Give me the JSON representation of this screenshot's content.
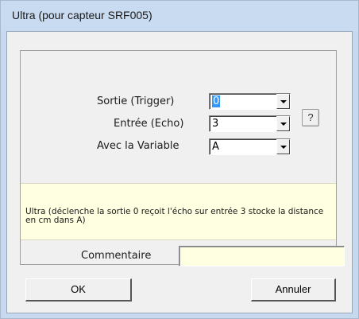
{
  "window": {
    "title": "Ultra (pour capteur SRF005)"
  },
  "form": {
    "trigger": {
      "label": "Sortie (Trigger)",
      "value": "0"
    },
    "echo": {
      "label": "Entrée (Echo)",
      "value": "3"
    },
    "variable": {
      "label": "Avec la Variable",
      "value": "A"
    },
    "help_label": "?"
  },
  "info": {
    "description": "Ultra (déclenche la sortie 0 reçoit l'écho sur entrée 3 stocke la distance en cm dans A)"
  },
  "comment": {
    "label": "Commentaire",
    "value": ""
  },
  "buttons": {
    "ok": "OK",
    "cancel": "Annuler"
  },
  "colors": {
    "info_background": "#ffffe1",
    "selection": "#3399ff",
    "frame": "#c7d9ee"
  },
  "icons": {
    "dropdown": "chevron-down-icon"
  }
}
